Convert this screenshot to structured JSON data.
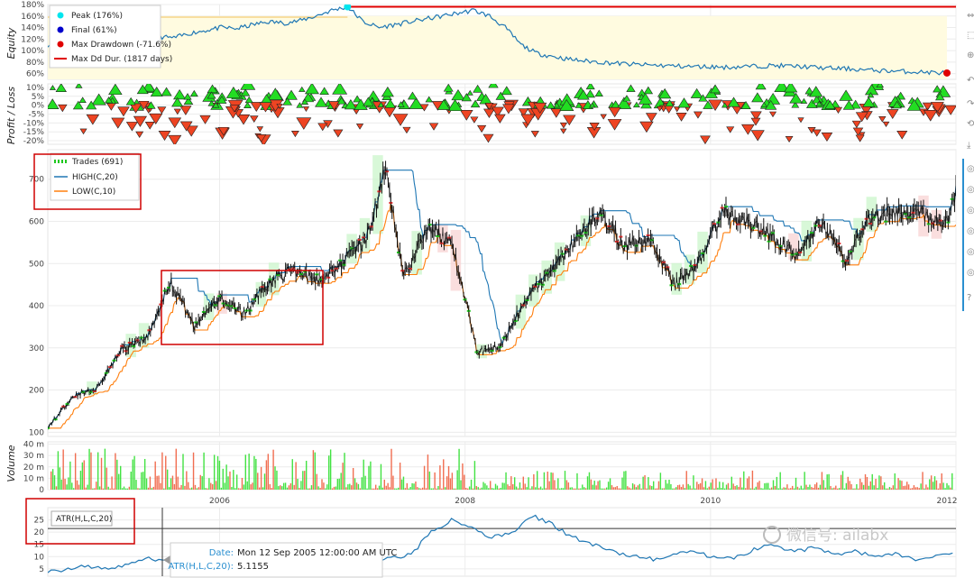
{
  "chart_data": [
    {
      "type": "line",
      "ylabel": "Equity",
      "ylim": [
        50,
        180
      ],
      "yticks": [
        "60%",
        "80%",
        "100%",
        "120%",
        "140%",
        "160%",
        "180%"
      ],
      "series": [
        {
          "name": "Equity",
          "values": [
            110,
            112,
            108,
            115,
            120,
            125,
            128,
            124,
            122,
            130,
            135,
            140,
            138,
            145,
            150,
            148,
            152,
            160,
            170,
            176,
            150,
            140,
            145,
            150,
            155,
            160,
            165,
            170,
            160,
            140,
            110,
            95,
            90,
            85,
            82,
            80,
            78,
            76,
            75,
            74,
            73,
            72,
            72,
            71,
            72,
            73,
            74,
            73,
            72,
            70,
            69,
            68,
            66,
            65,
            64,
            63,
            62,
            61
          ]
        }
      ],
      "legend": [
        {
          "label": "Peak (176%)",
          "color": "#00e5ee",
          "marker": "circle"
        },
        {
          "label": "Final (61%)",
          "color": "#0000cc",
          "marker": "circle"
        },
        {
          "label": "Max Drawdown (-71.6%)",
          "color": "#e00000",
          "marker": "circle"
        },
        {
          "label": "Max Dd Dur. (1817 days)",
          "color": "#e00000",
          "marker": "line"
        }
      ]
    },
    {
      "type": "scatter",
      "ylabel": "Profit / Loss",
      "ylim": [
        -22,
        12
      ],
      "yticks": [
        "-20%",
        "-15%",
        "-10%",
        "-5%",
        "0%",
        "5%",
        "10%"
      ]
    },
    {
      "type": "line",
      "ylim": [
        90,
        770
      ],
      "yticks": [
        "100",
        "200",
        "300",
        "400",
        "500",
        "600",
        "700"
      ],
      "xticks": [
        "2006",
        "2008",
        "2010",
        "2012"
      ],
      "x_range": [
        2004.6,
        2012.0
      ],
      "legend": [
        {
          "label": "Trades (691)",
          "color": "#1ec81e",
          "marker": "dash"
        },
        {
          "label": "HIGH(C,20)",
          "color": "#1f77b4",
          "marker": "line"
        },
        {
          "label": "LOW(C,10)",
          "color": "#ff7f0e",
          "marker": "line"
        }
      ],
      "x": [
        2004.6,
        2004.8,
        2005.0,
        2005.2,
        2005.4,
        2005.6,
        2005.8,
        2006.0,
        2006.2,
        2006.4,
        2006.6,
        2006.8,
        2007.0,
        2007.2,
        2007.35,
        2007.5,
        2007.7,
        2007.9,
        2008.1,
        2008.3,
        2008.5,
        2008.7,
        2008.9,
        2009.1,
        2009.3,
        2009.5,
        2009.7,
        2009.9,
        2010.1,
        2010.3,
        2010.5,
        2010.7,
        2010.9,
        2011.1,
        2011.3,
        2011.5,
        2011.7,
        2011.9,
        2012.0
      ],
      "close": [
        110,
        185,
        205,
        295,
        320,
        455,
        350,
        420,
        380,
        455,
        485,
        460,
        505,
        560,
        720,
        470,
        590,
        540,
        290,
        310,
        420,
        480,
        560,
        620,
        540,
        560,
        450,
        500,
        620,
        600,
        560,
        520,
        600,
        510,
        610,
        620,
        630,
        580,
        670
      ]
    },
    {
      "type": "bar",
      "ylabel": "Volume",
      "ylim": [
        0,
        42
      ],
      "yticks": [
        "0",
        "10 m",
        "20 m",
        "30 m",
        "40 m"
      ]
    },
    {
      "type": "line",
      "ylim": [
        2,
        30
      ],
      "yticks": [
        "5",
        "10",
        "15",
        "20",
        "25"
      ],
      "series": [
        {
          "name": "ATR(H,L,C,20)",
          "values": [
            4,
            5,
            6,
            5,
            7,
            9,
            8,
            14,
            12,
            8,
            7,
            9,
            8,
            10,
            12,
            9,
            8,
            9,
            11,
            20,
            25,
            22,
            18,
            20,
            27,
            23,
            18,
            15,
            12,
            10,
            9,
            11,
            12,
            10,
            9,
            13,
            15,
            12,
            14,
            11,
            12,
            10,
            11,
            9,
            10,
            12
          ]
        }
      ]
    }
  ],
  "tooltip": {
    "date_label": "Date:",
    "date_value": "Mon 12 Sep 2005 12:00:00 AM UTC",
    "atr_label": "ATR(H,L,C,20):",
    "atr_value": "5.1155"
  },
  "watermark": "微信号: ailabx",
  "colors": {
    "profit": "#22dd22",
    "loss": "#ee4422",
    "fill": "#fffbe0"
  }
}
